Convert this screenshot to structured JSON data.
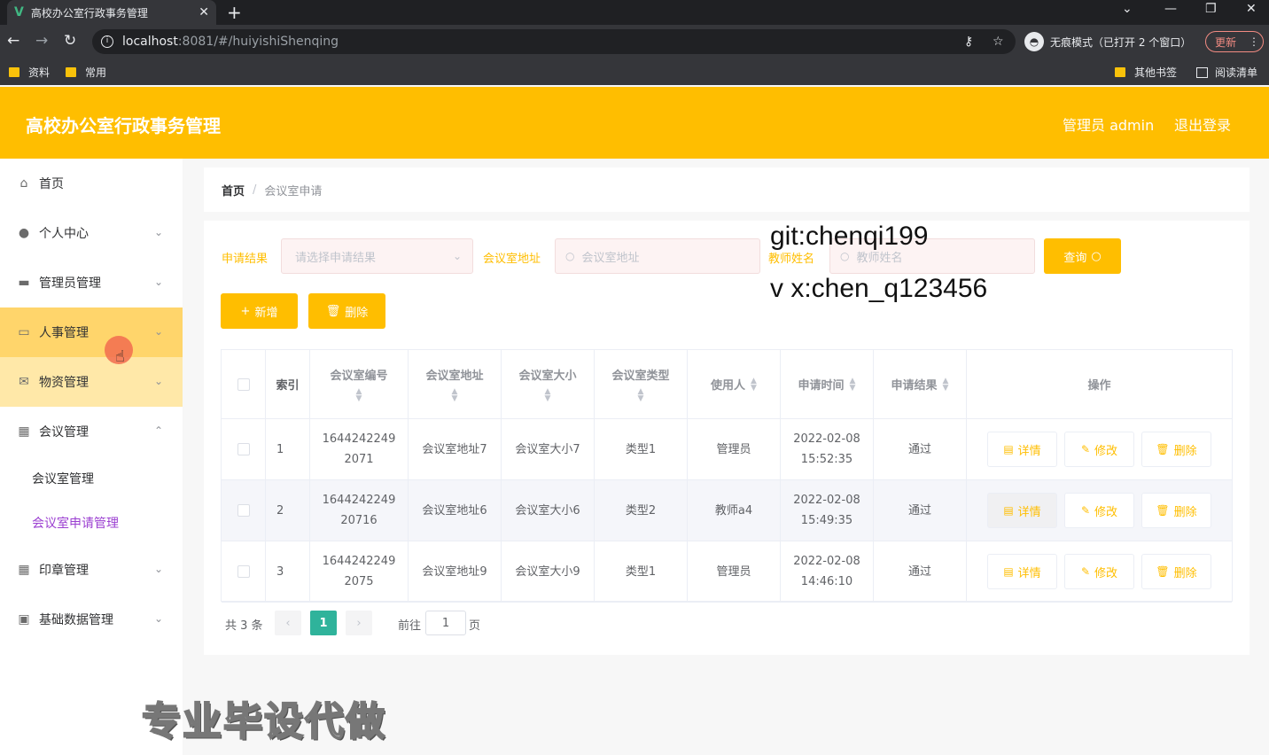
{
  "browser": {
    "tab_title": "高校办公室行政事务管理",
    "tab_favicon": "V",
    "url_host": "localhost",
    "url_path": ":8081/#/huiyishiShenqing",
    "incognito_label": "无痕模式（已打开 2 个窗口）",
    "update_label": "更新",
    "bookmarks": [
      "资料",
      "常用"
    ],
    "other_bookmarks": "其他书签",
    "reading_list": "阅读清单"
  },
  "header": {
    "title": "高校办公室行政事务管理",
    "admin": "管理员 admin",
    "logout": "退出登录",
    "color": "#ffbe00"
  },
  "sidebar": {
    "items": [
      {
        "label": "首页",
        "icon": "home-icon"
      },
      {
        "label": "个人中心",
        "icon": "user-icon"
      },
      {
        "label": "管理员管理",
        "icon": "briefcase-icon"
      },
      {
        "label": "人事管理",
        "icon": "laptop-icon"
      },
      {
        "label": "物资管理",
        "icon": "mail-icon"
      },
      {
        "label": "会议管理",
        "icon": "grid-icon"
      },
      {
        "label": "印章管理",
        "icon": "apps-icon"
      },
      {
        "label": "基础数据管理",
        "icon": "trash-icon"
      }
    ],
    "sub_items": [
      "会议室管理",
      "会议室申请管理"
    ]
  },
  "breadcrumb": {
    "home": "首页",
    "sep": "/",
    "current": "会议室申请"
  },
  "filters": {
    "result_label": "申请结果",
    "result_placeholder": "请选择申请结果",
    "address_label": "会议室地址",
    "address_placeholder": "会议室地址",
    "teacher_label": "教师姓名",
    "teacher_placeholder": "教师姓名",
    "query_button": "查询"
  },
  "actions": {
    "add": "新增",
    "delete": "删除"
  },
  "table": {
    "headers": [
      "索引",
      "会议室编号",
      "会议室地址",
      "会议室大小",
      "会议室类型",
      "使用人",
      "申请时间",
      "申请结果",
      "操作"
    ],
    "rows": [
      {
        "index": "1",
        "code_a": "1644242249",
        "code_b": "2071",
        "address": "会议室地址7",
        "size": "会议室大小7",
        "type": "类型1",
        "user": "管理员",
        "date": "2022-02-08",
        "time": "15:52:35",
        "result": "通过"
      },
      {
        "index": "2",
        "code_a": "1644242249",
        "code_b": "20716",
        "address": "会议室地址6",
        "size": "会议室大小6",
        "type": "类型2",
        "user": "教师a4",
        "date": "2022-02-08",
        "time": "15:49:35",
        "result": "通过"
      },
      {
        "index": "3",
        "code_a": "1644242249",
        "code_b": "2075",
        "address": "会议室地址9",
        "size": "会议室大小9",
        "type": "类型1",
        "user": "管理员",
        "date": "2022-02-08",
        "time": "14:46:10",
        "result": "通过"
      }
    ],
    "row_actions": {
      "detail": "详情",
      "edit": "修改",
      "delete": "删除"
    }
  },
  "pagination": {
    "total": "共 3 条",
    "current": "1",
    "goto_label": "前往",
    "goto_value": "1",
    "page_unit": "页"
  },
  "watermark": {
    "git": "git:chenqi199",
    "wx": "v x:chen_q123456",
    "bottom": "专业毕设代做"
  }
}
